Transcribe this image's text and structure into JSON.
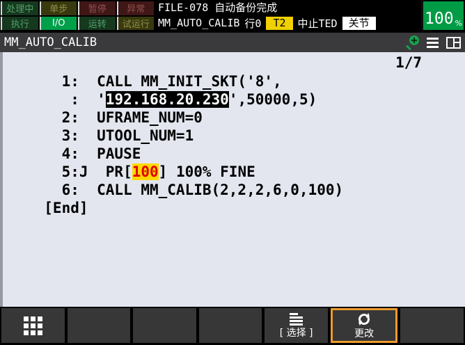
{
  "header": {
    "leds": [
      {
        "label": "处理中",
        "color": "green",
        "active": false
      },
      {
        "label": "单步",
        "color": "yellow",
        "active": false
      },
      {
        "label": "暂停",
        "color": "red",
        "active": false
      },
      {
        "label": "异常",
        "color": "red",
        "active": false
      },
      {
        "label": "执行",
        "color": "green",
        "active": false
      },
      {
        "label": "I/O",
        "color": "green",
        "active": true
      },
      {
        "label": "运转",
        "color": "green",
        "active": false
      },
      {
        "label": "试运行",
        "color": "yellow",
        "active": false
      }
    ],
    "message": "FILE-078 自动备份完成",
    "program_name": "MM_AUTO_CALIB",
    "line_label": "行0",
    "mode_badge": "T2",
    "abort_status": "中止TED",
    "coord_badge": "关节",
    "speed_value": "100",
    "speed_unit": "%"
  },
  "titlebar": {
    "title": "MM_AUTO_CALIB",
    "icons": [
      "zoom-in-icon",
      "menu-icon",
      "split-window-icon"
    ]
  },
  "program": {
    "page_indicator": "1/7",
    "lines": [
      {
        "a": "    1:  CALL MM_INIT_SKT('8',"
      },
      {
        "a": "     :  '",
        "selected": "192.168.20.230",
        "b": "',50000,5)"
      },
      {
        "a": "    2:  UFRAME_NUM=0"
      },
      {
        "a": "    3:  UTOOL_NUM=1"
      },
      {
        "a": "    4:  PAUSE"
      },
      {
        "a": "    5:J  PR[",
        "highlight": "100",
        "b": "] 100% FINE"
      },
      {
        "a": "    6:  CALL MM_CALIB(2,2,2,6,0,100)"
      },
      {
        "a": "  [End]"
      }
    ]
  },
  "softkeys": {
    "select_label": "[ 选择 ]",
    "change_label": "更改"
  },
  "colors": {
    "active_green": "#00a04a",
    "speed_green": "#009b45",
    "mode_yellow": "#f0d000",
    "selection_orange": "#ef9b2d",
    "pr_highlight_bg": "#ffd800",
    "pr_highlight_text": "#e00000",
    "main_background": "#e3e6ef"
  }
}
